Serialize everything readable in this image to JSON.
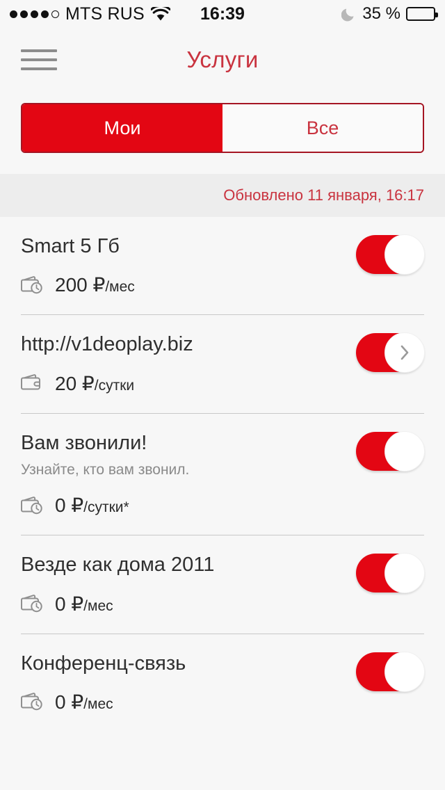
{
  "status_bar": {
    "signal_dots_filled": 4,
    "signal_dots_total": 5,
    "carrier": "MTS RUS",
    "wifi_icon": "wifi-icon",
    "time": "16:39",
    "dnd_icon": "moon-icon",
    "battery_percent": "35 %",
    "battery_level": 35
  },
  "nav": {
    "menu_icon": "hamburger-icon",
    "title": "Услуги"
  },
  "tabs": {
    "items": [
      {
        "label": "Мои",
        "active": true
      },
      {
        "label": "Все",
        "active": false
      }
    ]
  },
  "updated": {
    "text": "Обновлено 11 января, 16:17"
  },
  "colors": {
    "brand_red": "#e30613",
    "title_red": "#c9333f",
    "border_red": "#a51523",
    "page_bg": "#f7f7f7",
    "updated_bg": "#ededed",
    "divider": "#c8c8c8"
  },
  "services": [
    {
      "title": "Smart 5 Гб",
      "subtitle": "",
      "price_icon": "wallet-clock-icon",
      "price_amount": "200 ₽",
      "price_unit": "/мес",
      "toggle_on": true,
      "toggle_knob_icon": ""
    },
    {
      "title": "http://v1deoplay.biz",
      "subtitle": "",
      "price_icon": "wallet-icon",
      "price_amount": "20 ₽",
      "price_unit": "/сутки",
      "toggle_on": true,
      "toggle_knob_icon": "chevron-right-icon"
    },
    {
      "title": "Вам звонили!",
      "subtitle": "Узнайте, кто вам звонил.",
      "price_icon": "wallet-clock-icon",
      "price_amount": "0 ₽",
      "price_unit": "/сутки*",
      "toggle_on": true,
      "toggle_knob_icon": ""
    },
    {
      "title": "Везде как дома 2011",
      "subtitle": "",
      "price_icon": "wallet-clock-icon",
      "price_amount": "0 ₽",
      "price_unit": "/мес",
      "toggle_on": true,
      "toggle_knob_icon": ""
    },
    {
      "title": "Конференц-связь",
      "subtitle": "",
      "price_icon": "wallet-clock-icon",
      "price_amount": "0 ₽",
      "price_unit": "/мес",
      "toggle_on": true,
      "toggle_knob_icon": ""
    }
  ]
}
